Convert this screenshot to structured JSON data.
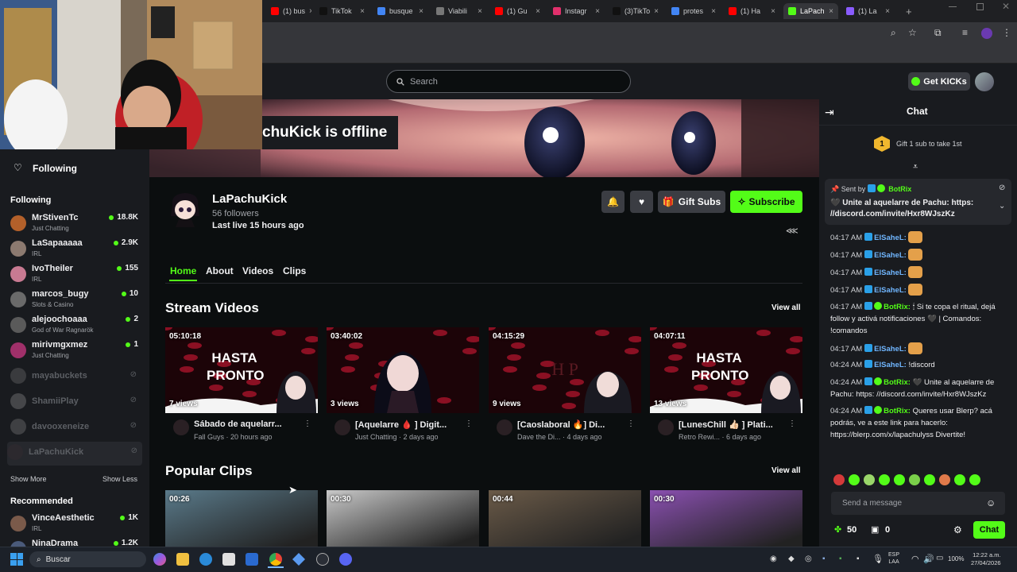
{
  "browser": {
    "tabs": [
      {
        "label": "(1) bus",
        "color": "#ff0000"
      },
      {
        "label": "TikTok",
        "color": "#111111"
      },
      {
        "label": "busque",
        "color": "#4285f4"
      },
      {
        "label": "Viabili",
        "color": "#777777"
      },
      {
        "label": "(1) Gu",
        "color": "#ff0000"
      },
      {
        "label": "Instagr",
        "color": "#e1306c"
      },
      {
        "label": "(3)TikTo",
        "color": "#111111"
      },
      {
        "label": "protes",
        "color": "#4285f4"
      },
      {
        "label": "(1) Ha",
        "color": "#ff0000"
      },
      {
        "label": "LaPach",
        "color": "#53fc18"
      },
      {
        "label": "(1) La",
        "color": "#8a5cff"
      }
    ],
    "new_tab": "+"
  },
  "header": {
    "search_placeholder": "Search",
    "get_kicks": "Get KICKs"
  },
  "banner": {
    "offline_text": "chuKick is offline"
  },
  "sidebar": {
    "following_title": "Following",
    "following_label": "Following",
    "channels": [
      {
        "name": "MrStivenTc",
        "category": "Just Chatting",
        "viewers": "18.8K",
        "live": true,
        "color": "#b3602a"
      },
      {
        "name": "LaSapaaaaa",
        "category": "IRL",
        "viewers": "2.9K",
        "live": true,
        "color": "#8c7a70"
      },
      {
        "name": "IvoTheiler",
        "category": "IRL",
        "viewers": "155",
        "live": true,
        "color": "#c87a92"
      },
      {
        "name": "marcos_bugy",
        "category": "Slots & Casino",
        "viewers": "10",
        "live": true,
        "color": "#6a6a6a"
      },
      {
        "name": "alejoochoaaa",
        "category": "God of War Ragnarök",
        "viewers": "2",
        "live": true,
        "color": "#5a5a5a"
      },
      {
        "name": "mirivmgxmez",
        "category": "Just Chatting",
        "viewers": "1",
        "live": true,
        "color": "#a0306a"
      },
      {
        "name": "mayabuckets",
        "category": "",
        "viewers": "",
        "live": false,
        "color": "#777"
      },
      {
        "name": "ShamiiPlay",
        "category": "",
        "viewers": "",
        "live": false,
        "color": "#999"
      },
      {
        "name": "davooxeneize",
        "category": "",
        "viewers": "",
        "live": false,
        "color": "#888"
      },
      {
        "name": "LaPachuKick",
        "category": "",
        "viewers": "",
        "live": false,
        "color": "#3a2a30"
      }
    ],
    "show_more": "Show More",
    "show_less": "Show Less",
    "recommended_label": "Recommended",
    "recommended": [
      {
        "name": "VinceAesthetic",
        "category": "IRL",
        "viewers": "1K",
        "color": "#7a5a4a"
      },
      {
        "name": "NinaDrama",
        "category": "",
        "viewers": "1.2K",
        "color": "#4a5a7a"
      }
    ]
  },
  "channel": {
    "name": "LaPachuKick",
    "followers": "56 followers",
    "last_live": "Last live 15 hours ago",
    "gift_subs": "Gift Subs",
    "subscribe": "Subscribe",
    "tabs": [
      "Home",
      "About",
      "Videos",
      "Clips"
    ]
  },
  "stream_videos": {
    "title": "Stream Videos",
    "view_all": "View all",
    "items": [
      {
        "duration": "05:10:18",
        "views": "7 views",
        "title": "Sábado de aquelarr...",
        "meta": "Fall Guys · 20 hours ago",
        "thumb": "hasta"
      },
      {
        "duration": "03:40:02",
        "views": "3 views",
        "title": "[Aquelarre 🩸 ] Digit...",
        "meta": "Just Chatting · 2 days ago",
        "thumb": "girl"
      },
      {
        "duration": "04:15:29",
        "views": "9 views",
        "title": "[Caoslaboral 🔥] Di...",
        "meta": "Dave the Di... · 4 days ago",
        "thumb": "hp"
      },
      {
        "duration": "04:07:11",
        "views": "13 views",
        "title": "[LunesChill 👍🏻 ] Plati...",
        "meta": "Retro Rewi... · 6 days ago",
        "thumb": "hasta"
      }
    ],
    "thumb_text": "HASTA PRONTO"
  },
  "popular_clips": {
    "title": "Popular Clips",
    "view_all": "View all",
    "items": [
      {
        "duration": "00:26",
        "color": "#5a7a8a"
      },
      {
        "duration": "00:30",
        "color": "#c8c8c8"
      },
      {
        "duration": "00:44",
        "color": "#6a5a48"
      },
      {
        "duration": "00:30",
        "color": "#8a50b0"
      }
    ]
  },
  "chat": {
    "title": "Chat",
    "gift_text": "Gift 1 sub to take 1st",
    "gift_rank": "1",
    "pinned_sent_by": "Sent by",
    "pinned_user": "BotRix",
    "pinned_text": "🖤 Unite al aquelarre de Pachu: https: //discord.com/invite/Hxr8WJszKz",
    "messages": [
      {
        "time": "04:17 AM",
        "user": "ElSaheL:",
        "text": "",
        "emote": true,
        "bot": false
      },
      {
        "time": "04:17 AM",
        "user": "ElSaheL:",
        "text": "",
        "emote": true,
        "bot": false
      },
      {
        "time": "04:17 AM",
        "user": "ElSaheL:",
        "text": "",
        "emote": true,
        "bot": false
      },
      {
        "time": "04:17 AM",
        "user": "ElSaheL:",
        "text": "",
        "emote": true,
        "bot": false
      },
      {
        "time": "04:17 AM",
        "user": "BotRix:",
        "text": "🕯 Si te copa el ritual, dejá follow y activá notificaciones 🖤 | Comandos: !comandos",
        "emote": false,
        "bot": true
      },
      {
        "time": "04:17 AM",
        "user": "ElSaheL:",
        "text": "",
        "emote": true,
        "bot": false
      },
      {
        "time": "04:24 AM",
        "user": "ElSaheL:",
        "text": "!discord",
        "emote": false,
        "bot": false
      },
      {
        "time": "04:24 AM",
        "user": "BotRix:",
        "text": "🖤 Unite al aquelarre de Pachu: https: //discord.com/invite/Hxr8WJszKz",
        "emote": false,
        "bot": true
      },
      {
        "time": "04:24 AM",
        "user": "BotRix:",
        "text": "Queres usar Blerp? acá podrás, ve a este link para hacerlo: https://blerp.com/x/lapachulyss Divertite!",
        "emote": false,
        "bot": true
      }
    ],
    "input_placeholder": "Send a message",
    "points": "50",
    "drops": "0",
    "send": "Chat"
  },
  "taskbar": {
    "search": "Buscar",
    "lang": "ESP",
    "lang2": "LAA",
    "battery": "100%",
    "time": "12:22 a.m.",
    "date": "27/04/2026"
  }
}
